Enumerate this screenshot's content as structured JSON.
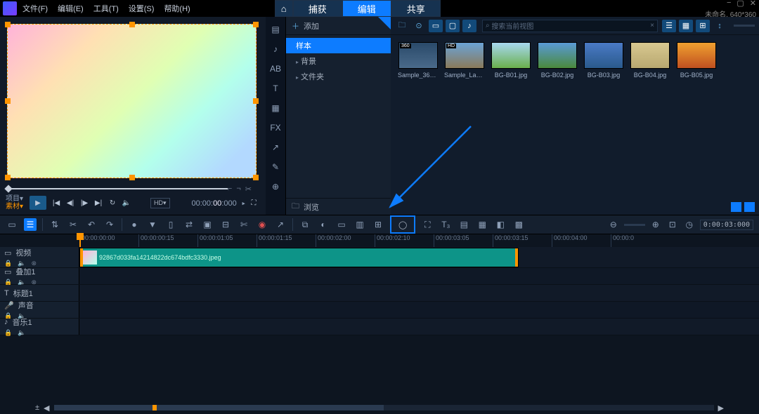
{
  "menu": {
    "file": "文件(F)",
    "edit": "编辑(E)",
    "tools": "工具(T)",
    "settings": "设置(S)",
    "help": "帮助(H)"
  },
  "tabs": {
    "capture": "捕获",
    "edit": "编辑",
    "share": "共享"
  },
  "project": {
    "name": "未命名",
    "dims": "640*360"
  },
  "preview": {
    "mode1": "项目▾",
    "mode2": "素材▾",
    "timecode_pre": "00:00:",
    "timecode_sec": "00",
    "timecode_frm": ":000",
    "hd": "HD▾",
    "opt1": "⟲",
    "opt2": "↔",
    "opt3": "⛶"
  },
  "sidetools": [
    "gallery",
    "music",
    "transition",
    "subtitle",
    "text",
    "filter",
    "fx",
    "path",
    "paint",
    "ab"
  ],
  "library": {
    "add": "添加",
    "tree": {
      "samples": "样本",
      "background": "背景",
      "folder": "文件夹"
    },
    "browse": "浏览"
  },
  "media": {
    "search_placeholder": "搜索当前视图",
    "thumbs": [
      {
        "label": "Sample_360.m...",
        "badge": "360"
      },
      {
        "label": "Sample_Lake....",
        "badge": "HD"
      },
      {
        "label": "BG-B01.jpg"
      },
      {
        "label": "BG-B02.jpg"
      },
      {
        "label": "BG-B03.jpg"
      },
      {
        "label": "BG-B04.jpg"
      },
      {
        "label": "BG-B05.jpg"
      }
    ]
  },
  "toolbar": {
    "tc": "0:00:03:000"
  },
  "ruler": [
    "00:00:00:00",
    "00:00:00:15",
    "00:00:01:05",
    "00:00:01:15",
    "00:00:02:00",
    "00:00:02:10",
    "00:00:03:05",
    "00:00:03:15",
    "00:00:04:00"
  ],
  "tracks": {
    "video": "视频",
    "overlay": "叠加1",
    "title": "标题1",
    "voice": "声音",
    "music": "音乐1"
  },
  "clip": {
    "name": "92867d033fa14214822dc674bdfc3330.jpeg"
  },
  "tl_tc_end": "00:00:0"
}
